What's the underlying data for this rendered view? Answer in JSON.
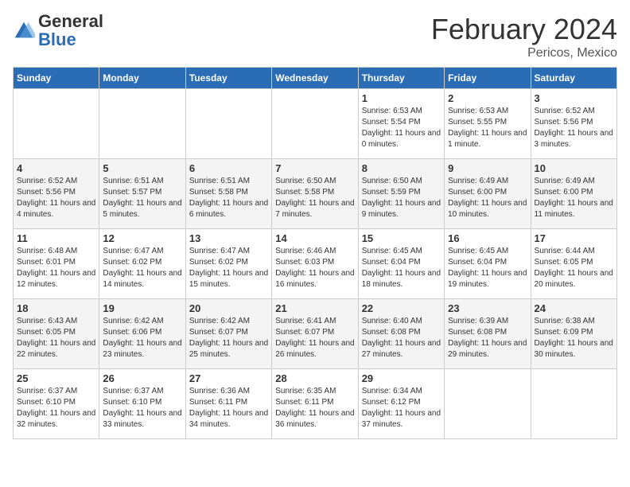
{
  "logo": {
    "general": "General",
    "blue": "Blue"
  },
  "header": {
    "month": "February 2024",
    "location": "Pericos, Mexico"
  },
  "days_of_week": [
    "Sunday",
    "Monday",
    "Tuesday",
    "Wednesday",
    "Thursday",
    "Friday",
    "Saturday"
  ],
  "weeks": [
    [
      {
        "day": "",
        "info": ""
      },
      {
        "day": "",
        "info": ""
      },
      {
        "day": "",
        "info": ""
      },
      {
        "day": "",
        "info": ""
      },
      {
        "day": "1",
        "info": "Sunrise: 6:53 AM\nSunset: 5:54 PM\nDaylight: 11 hours and 0 minutes."
      },
      {
        "day": "2",
        "info": "Sunrise: 6:53 AM\nSunset: 5:55 PM\nDaylight: 11 hours and 1 minute."
      },
      {
        "day": "3",
        "info": "Sunrise: 6:52 AM\nSunset: 5:56 PM\nDaylight: 11 hours and 3 minutes."
      }
    ],
    [
      {
        "day": "4",
        "info": "Sunrise: 6:52 AM\nSunset: 5:56 PM\nDaylight: 11 hours and 4 minutes."
      },
      {
        "day": "5",
        "info": "Sunrise: 6:51 AM\nSunset: 5:57 PM\nDaylight: 11 hours and 5 minutes."
      },
      {
        "day": "6",
        "info": "Sunrise: 6:51 AM\nSunset: 5:58 PM\nDaylight: 11 hours and 6 minutes."
      },
      {
        "day": "7",
        "info": "Sunrise: 6:50 AM\nSunset: 5:58 PM\nDaylight: 11 hours and 7 minutes."
      },
      {
        "day": "8",
        "info": "Sunrise: 6:50 AM\nSunset: 5:59 PM\nDaylight: 11 hours and 9 minutes."
      },
      {
        "day": "9",
        "info": "Sunrise: 6:49 AM\nSunset: 6:00 PM\nDaylight: 11 hours and 10 minutes."
      },
      {
        "day": "10",
        "info": "Sunrise: 6:49 AM\nSunset: 6:00 PM\nDaylight: 11 hours and 11 minutes."
      }
    ],
    [
      {
        "day": "11",
        "info": "Sunrise: 6:48 AM\nSunset: 6:01 PM\nDaylight: 11 hours and 12 minutes."
      },
      {
        "day": "12",
        "info": "Sunrise: 6:47 AM\nSunset: 6:02 PM\nDaylight: 11 hours and 14 minutes."
      },
      {
        "day": "13",
        "info": "Sunrise: 6:47 AM\nSunset: 6:02 PM\nDaylight: 11 hours and 15 minutes."
      },
      {
        "day": "14",
        "info": "Sunrise: 6:46 AM\nSunset: 6:03 PM\nDaylight: 11 hours and 16 minutes."
      },
      {
        "day": "15",
        "info": "Sunrise: 6:45 AM\nSunset: 6:04 PM\nDaylight: 11 hours and 18 minutes."
      },
      {
        "day": "16",
        "info": "Sunrise: 6:45 AM\nSunset: 6:04 PM\nDaylight: 11 hours and 19 minutes."
      },
      {
        "day": "17",
        "info": "Sunrise: 6:44 AM\nSunset: 6:05 PM\nDaylight: 11 hours and 20 minutes."
      }
    ],
    [
      {
        "day": "18",
        "info": "Sunrise: 6:43 AM\nSunset: 6:05 PM\nDaylight: 11 hours and 22 minutes."
      },
      {
        "day": "19",
        "info": "Sunrise: 6:42 AM\nSunset: 6:06 PM\nDaylight: 11 hours and 23 minutes."
      },
      {
        "day": "20",
        "info": "Sunrise: 6:42 AM\nSunset: 6:07 PM\nDaylight: 11 hours and 25 minutes."
      },
      {
        "day": "21",
        "info": "Sunrise: 6:41 AM\nSunset: 6:07 PM\nDaylight: 11 hours and 26 minutes."
      },
      {
        "day": "22",
        "info": "Sunrise: 6:40 AM\nSunset: 6:08 PM\nDaylight: 11 hours and 27 minutes."
      },
      {
        "day": "23",
        "info": "Sunrise: 6:39 AM\nSunset: 6:08 PM\nDaylight: 11 hours and 29 minutes."
      },
      {
        "day": "24",
        "info": "Sunrise: 6:38 AM\nSunset: 6:09 PM\nDaylight: 11 hours and 30 minutes."
      }
    ],
    [
      {
        "day": "25",
        "info": "Sunrise: 6:37 AM\nSunset: 6:10 PM\nDaylight: 11 hours and 32 minutes."
      },
      {
        "day": "26",
        "info": "Sunrise: 6:37 AM\nSunset: 6:10 PM\nDaylight: 11 hours and 33 minutes."
      },
      {
        "day": "27",
        "info": "Sunrise: 6:36 AM\nSunset: 6:11 PM\nDaylight: 11 hours and 34 minutes."
      },
      {
        "day": "28",
        "info": "Sunrise: 6:35 AM\nSunset: 6:11 PM\nDaylight: 11 hours and 36 minutes."
      },
      {
        "day": "29",
        "info": "Sunrise: 6:34 AM\nSunset: 6:12 PM\nDaylight: 11 hours and 37 minutes."
      },
      {
        "day": "",
        "info": ""
      },
      {
        "day": "",
        "info": ""
      }
    ]
  ]
}
